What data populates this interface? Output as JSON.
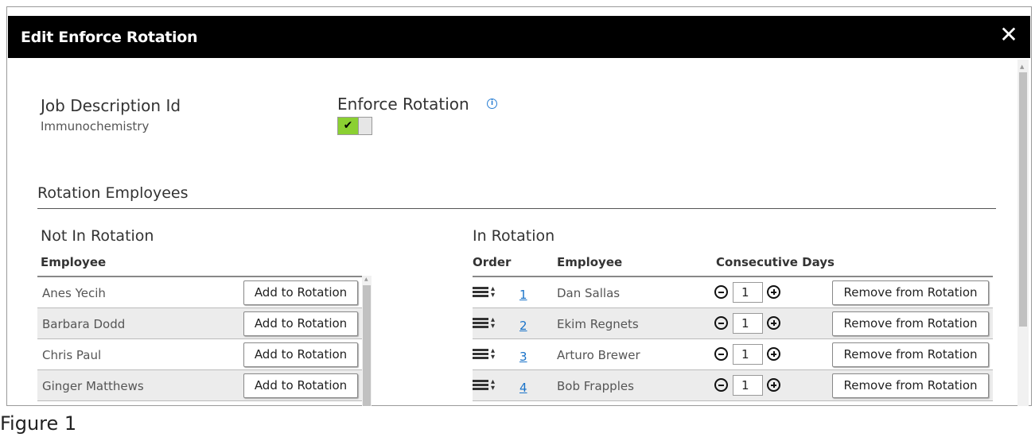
{
  "dialog": {
    "title": "Edit Enforce Rotation",
    "close_glyph": "✕"
  },
  "job_description": {
    "label": "Job Description Id",
    "value": "Immunochemistry"
  },
  "enforce_rotation": {
    "label": "Enforce Rotation",
    "info_glyph": "i",
    "toggle_on": true,
    "toggle_glyph": "✔"
  },
  "rotation_employees": {
    "section_title": "Rotation Employees",
    "not_in_rotation": {
      "title": "Not In Rotation",
      "column_header": "Employee",
      "button_label": "Add to Rotation",
      "rows": [
        {
          "employee": "Anes Yecih"
        },
        {
          "employee": "Barbara Dodd"
        },
        {
          "employee": "Chris Paul"
        },
        {
          "employee": "Ginger Matthews"
        }
      ]
    },
    "in_rotation": {
      "title": "In Rotation",
      "columns": [
        "Order",
        "Employee",
        "Consecutive Days"
      ],
      "button_label": "Remove from Rotation",
      "rows": [
        {
          "order": "1",
          "employee": "Dan Sallas",
          "days": "1"
        },
        {
          "order": "2",
          "employee": "Ekim Regnets",
          "days": "1"
        },
        {
          "order": "3",
          "employee": "Arturo Brewer",
          "days": "1"
        },
        {
          "order": "4",
          "employee": "Bob Frapples",
          "days": "1"
        }
      ]
    }
  },
  "caption": "Figure 1",
  "colors": {
    "titlebar": "#000000",
    "toggle_on": "#8bd032",
    "link": "#1a73c9",
    "alt_row": "#ececec"
  },
  "icons": [
    "close-icon",
    "info-icon",
    "check-icon",
    "drag-handle-icon",
    "minus-circle-icon",
    "plus-circle-icon"
  ]
}
